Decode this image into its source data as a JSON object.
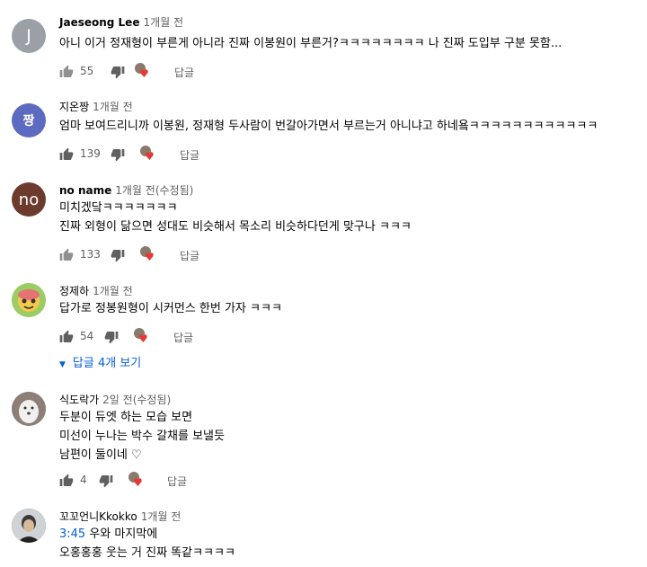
{
  "reply_label": "답글",
  "comments": [
    {
      "avatar_letter": "J",
      "avatar_color": "#9aa0a6",
      "author": "Jaeseong Lee",
      "time": "1개월 전",
      "lines": [
        "아니 이거 정재형이 부른게 아니라 진짜 이봉원이 부른거?ㅋㅋㅋㅋㅋㅋㅋㅋ 나 진짜 도입부 구분 못함..."
      ],
      "likes": "55"
    },
    {
      "avatar_letter": "짱",
      "avatar_color": "#5c6bc0",
      "author": "지온짱",
      "time": "1개월 전",
      "lines": [
        "엄마 보여드리니까 이봉원, 정재형 두사람이 번갈아가면서 부르는거 아니냐고 하네욬ㅋㅋㅋㅋㅋㅋㅋㅋㅋㅋㅋㅋ"
      ],
      "likes": "139"
    },
    {
      "avatar_letter": "no",
      "avatar_color": "#6d3b2e",
      "author": "no name",
      "time": "1개월 전(수정됨)",
      "lines": [
        "미치겠닼ㅋㅋㅋㅋㅋㅋㅋ",
        "진짜 외형이 닮으면 성대도 비슷해서 목소리 비슷하다던게 맞구나 ㅋㅋㅋ"
      ],
      "likes": "133"
    },
    {
      "avatar_letter": "",
      "avatar_color": "#9ccc65",
      "author": "정제하",
      "time": "1개월 전",
      "lines": [
        "답가로 정봉원형이 시커먼스 한번 가자 ㅋㅋㅋ"
      ],
      "likes": "54",
      "view_replies": "답글 4개 보기"
    },
    {
      "avatar_letter": "",
      "avatar_color": "#b0a6a0",
      "author": "식도락가",
      "time": "2일 전(수정됨)",
      "lines": [
        "두분이 듀엣 하는 모습 보면",
        "미선이 누나는 박수 갈채를 보낼듯",
        "남편이 둘이네 ♡"
      ],
      "likes": "4"
    },
    {
      "avatar_letter": "",
      "avatar_color": "#37474f",
      "author": "꼬꼬언니Kkokko",
      "time": "1개월 전",
      "timestamp_link": "3:45",
      "lines": [
        " 우와 마지막에",
        "오홍홍홍 웃는 거 진짜 똑같ㅋㅋㅋㅋ"
      ]
    }
  ]
}
